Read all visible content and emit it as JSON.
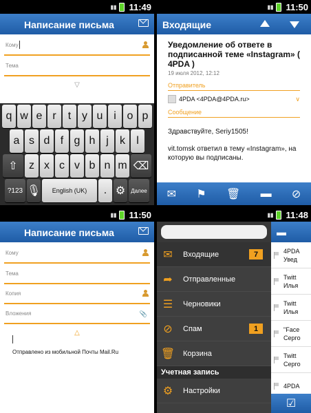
{
  "panel1": {
    "status_time": "11:49",
    "title": "Написание письма",
    "to_label": "Кому",
    "subject_label": "Тема",
    "keyboard": {
      "row1": [
        "q",
        "w",
        "e",
        "r",
        "t",
        "y",
        "u",
        "i",
        "o",
        "p"
      ],
      "row2": [
        "a",
        "s",
        "d",
        "f",
        "g",
        "h",
        "j",
        "k",
        "l"
      ],
      "row3": [
        "z",
        "x",
        "c",
        "v",
        "b",
        "n",
        "m"
      ],
      "mode_key": "?123",
      "space_label": "English (UK)",
      "dot_key": ".",
      "go_key": "Далее"
    }
  },
  "panel2": {
    "status_time": "11:50",
    "title": "Входящие",
    "subject": "Уведомление об ответе в подписанной теме «Instagram» ( 4PDA )",
    "date": "19 июля 2012, 12:12",
    "sender_label": "Отправитель",
    "sender": "4PDA <4PDA@4PDA.ru>",
    "message_label": "Сообщение",
    "greeting": "Здравствуйте, Seriy1505!",
    "body": "vit.tomsk ответил в тему «Instagram», на которую вы подписаны."
  },
  "panel3": {
    "status_time": "11:50",
    "title": "Написание письма",
    "to_label": "Кому",
    "subject_label": "Тема",
    "cc_label": "Копия",
    "attachments_label": "Вложения",
    "signature": "Отправлено из мобильной Почты Mail.Ru"
  },
  "panel4": {
    "status_time": "11:48",
    "menu": [
      {
        "label": "Входящие",
        "badge": "7",
        "icon": "inbox-icon"
      },
      {
        "label": "Отправленные",
        "badge": "",
        "icon": "sent-icon"
      },
      {
        "label": "Черновики",
        "badge": "",
        "icon": "drafts-icon"
      },
      {
        "label": "Спам",
        "badge": "1",
        "icon": "spam-icon"
      },
      {
        "label": "Корзина",
        "badge": "",
        "icon": "trash-icon"
      }
    ],
    "account_section": "Учетная запись",
    "settings_label": "Настройки",
    "list_items": [
      "4PDA Увед",
      "Twitt Илья",
      "Twitt Илья",
      "\"Face Серго",
      "Twitt Серго",
      "4PDA"
    ]
  },
  "colors": {
    "accent": "#f0a020",
    "header_blue": "#2a6db8",
    "sidebar": "#3f3f3f"
  }
}
